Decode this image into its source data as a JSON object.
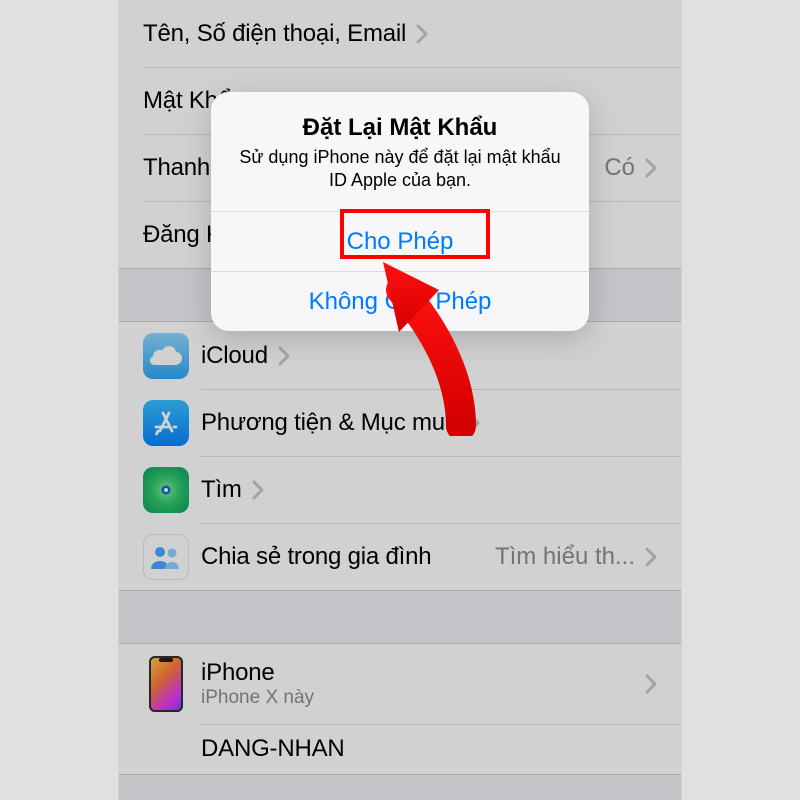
{
  "settings": {
    "group1": {
      "name_phone_email": "Tên, Số điện thoại, Email",
      "password": "Mật Khẩu",
      "payment": "Thanh Toán",
      "payment_trail": "Có",
      "subscriptions": "Đăng Ký"
    },
    "group2": {
      "icloud": "iCloud",
      "media": "Phương tiện & Mục mua",
      "find": "Tìm",
      "family": "Chia sẻ trong gia đình",
      "family_trail": "Tìm hiểu th..."
    },
    "group3": {
      "device_name": "iPhone",
      "device_sub": "iPhone X này",
      "device2_name": "DANG-NHAN"
    }
  },
  "alert": {
    "title": "Đặt Lại Mật Khẩu",
    "message": "Sử dụng iPhone này để đặt lại mật khẩu ID Apple của bạn.",
    "allow": "Cho Phép",
    "deny": "Không Cho Phép"
  }
}
